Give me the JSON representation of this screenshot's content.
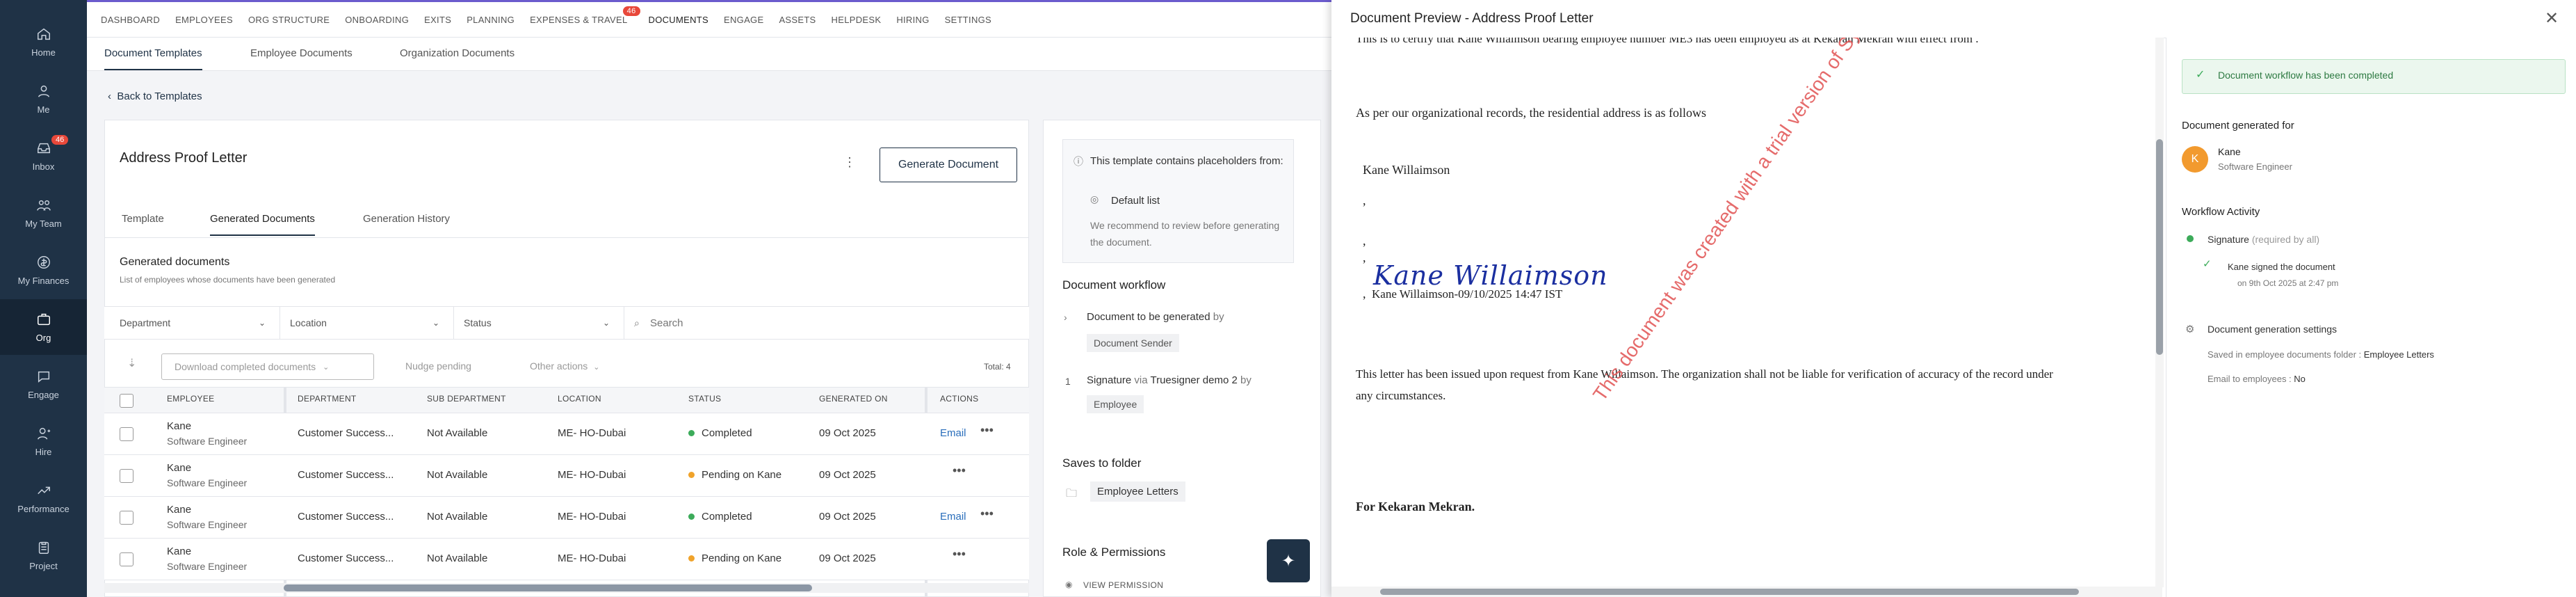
{
  "sidebar": {
    "items": [
      {
        "label": "Home"
      },
      {
        "label": "Me"
      },
      {
        "label": "Inbox",
        "badge": "46"
      },
      {
        "label": "My Team"
      },
      {
        "label": "My Finances"
      },
      {
        "label": "Org"
      },
      {
        "label": "Engage"
      },
      {
        "label": "Hire"
      },
      {
        "label": "Performance"
      },
      {
        "label": "Project"
      }
    ]
  },
  "topnav": {
    "items": [
      "DASHBOARD",
      "EMPLOYEES",
      "ORG STRUCTURE",
      "ONBOARDING",
      "EXITS",
      "PLANNING",
      "EXPENSES & TRAVEL",
      "DOCUMENTS",
      "ENGAGE",
      "ASSETS",
      "HELPDESK",
      "HIRING",
      "SETTINGS"
    ],
    "expenses_badge": "46"
  },
  "subnav": {
    "tabs": [
      "Document Templates",
      "Employee Documents",
      "Organization Documents"
    ]
  },
  "back_label": "Back to Templates",
  "template": {
    "title": "Address Proof Letter",
    "generate_label": "Generate Document",
    "tabs": [
      "Template",
      "Generated Documents",
      "Generation History"
    ]
  },
  "generated": {
    "heading": "Generated documents",
    "subheading": "List of employees whose documents have been generated"
  },
  "filters": {
    "department": "Department",
    "location": "Location",
    "status": "Status",
    "search_placeholder": "Search"
  },
  "toolbar": {
    "download": "Download completed documents",
    "nudge": "Nudge pending",
    "other": "Other actions",
    "total": "Total: 4"
  },
  "table": {
    "headers": [
      "EMPLOYEE",
      "DEPARTMENT",
      "SUB DEPARTMENT",
      "LOCATION",
      "STATUS",
      "GENERATED ON",
      "ACTIONS"
    ],
    "rows": [
      {
        "name": "Kane",
        "title": "Software Engineer",
        "dept": "Customer Success...",
        "sub": "Not Available",
        "loc": "ME- HO-Dubai",
        "status": "Completed",
        "date": "09 Oct 2025",
        "email": "Email",
        "status_color": "#3cab5a"
      },
      {
        "name": "Kane",
        "title": "Software Engineer",
        "dept": "Customer Success...",
        "sub": "Not Available",
        "loc": "ME- HO-Dubai",
        "status": "Pending on Kane",
        "date": "09 Oct 2025",
        "email": "",
        "status_color": "#f0a32b"
      },
      {
        "name": "Kane",
        "title": "Software Engineer",
        "dept": "Customer Success...",
        "sub": "Not Available",
        "loc": "ME- HO-Dubai",
        "status": "Completed",
        "date": "09 Oct 2025",
        "email": "Email",
        "status_color": "#3cab5a"
      },
      {
        "name": "Kane",
        "title": "Software Engineer",
        "dept": "Customer Success...",
        "sub": "Not Available",
        "loc": "ME- HO-Dubai",
        "status": "Pending on Kane",
        "date": "09 Oct 2025",
        "email": "",
        "status_color": "#f0a32b"
      }
    ]
  },
  "info": {
    "line1": "This template contains placeholders from:",
    "default_list": "Default list",
    "recommend": "We recommend to review before generating the document."
  },
  "workflow": {
    "heading": "Document workflow",
    "step1": "Document to be generated",
    "by": "by",
    "sender": "Document Sender",
    "step2_num": "1",
    "step2": "Signature",
    "via": "via",
    "signer": "Truesigner demo 2",
    "employee": "Employee"
  },
  "saves": {
    "heading": "Saves to folder",
    "folder": "Employee Letters"
  },
  "roles": {
    "heading": "Role & Permissions",
    "view": "VIEW PERMISSION"
  },
  "preview": {
    "title": "Document Preview - Address Proof Letter",
    "line_top": "This is to certify that Kane Willaimson bearing employee number ME3 has been employed as  at   Kekaran Mekran with effect from .",
    "line_address": "As per our organizational records, the residential address is as follows",
    "name": "Kane Willaimson",
    "comma": ",",
    "signature": "Kane Willaimson",
    "signature_caption": "Kane Willaimson-09/10/2025 14:47 IST",
    "body1": "This letter has been issued upon request from Kane Willaimson. The organization shall not be liable for verification of accuracy of the record under",
    "body2": "any circumstances.",
    "sign_off": "For Kekaran Mekran.",
    "watermark": "This document was created with a trial version of Syncfusion PDF library."
  },
  "status_panel": {
    "banner": "Document workflow has been completed",
    "generated_for": "Document generated for",
    "avatar": "K",
    "name": "Kane",
    "title": "Software Engineer",
    "activity": "Workflow Activity",
    "signature": "Signature",
    "required": "(required by all)",
    "signed": "Kane signed the document",
    "signed_on": "on 9th Oct 2025 at 2:47 pm",
    "settings": "Document generation settings",
    "saved_in": "Saved in employee documents folder :",
    "folder": "Employee Letters",
    "email_label": "Email to employees :",
    "email_value": "No"
  }
}
